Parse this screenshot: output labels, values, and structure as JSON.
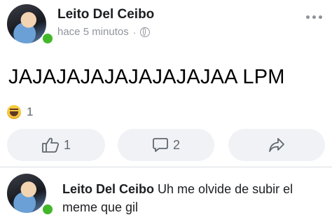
{
  "post": {
    "author": "Leito Del Ceibo",
    "time": "hace 5 minutos",
    "separator": "·",
    "privacy_icon": "globe-icon",
    "menu_icon": "more-options-icon",
    "text": "JAJAJAJAJAJAJAJAJAA LPM",
    "reactions": {
      "icon": "haha-reaction-icon",
      "count": "1"
    }
  },
  "actions": {
    "like": {
      "icon": "like-icon",
      "count": "1"
    },
    "comment": {
      "icon": "comment-icon",
      "count": "2"
    },
    "share": {
      "icon": "share-icon"
    }
  },
  "comment": {
    "author": "Leito Del Ceibo",
    "text": "Uh me olvide de subir el meme que gil"
  },
  "colors": {
    "online": "#42b72a",
    "button_bg": "#f0f2f5",
    "muted_text": "#90949c"
  }
}
